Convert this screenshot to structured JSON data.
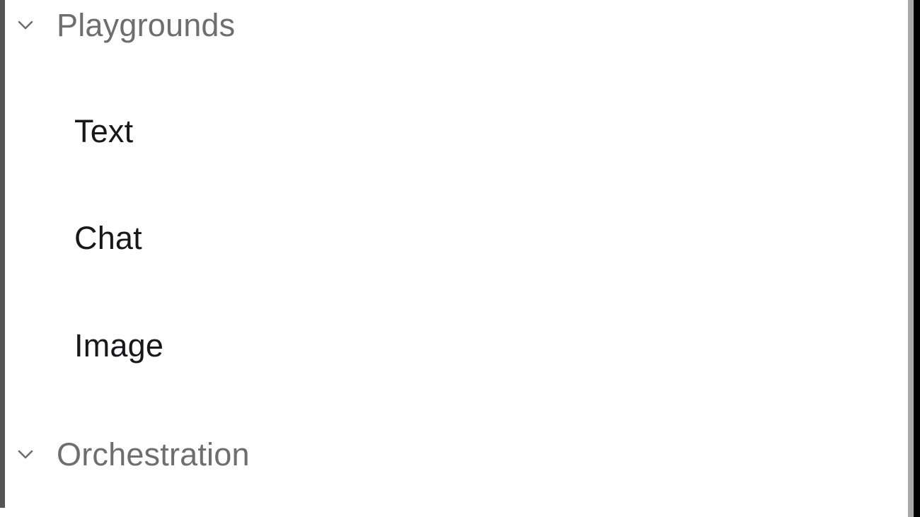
{
  "sidebar": {
    "groups": [
      {
        "id": "playgrounds",
        "label": "Playgrounds",
        "icon": "chevron-down-icon",
        "expanded": true,
        "items": [
          {
            "id": "text",
            "label": "Text"
          },
          {
            "id": "chat",
            "label": "Chat"
          },
          {
            "id": "image",
            "label": "Image"
          }
        ]
      },
      {
        "id": "orchestration",
        "label": "Orchestration",
        "icon": "chevron-down-icon",
        "expanded": true,
        "items": []
      }
    ]
  },
  "colors": {
    "group_label": "#6e6e6e",
    "item_label": "#18181b",
    "chevron": "#6e6e6e",
    "background": "#ffffff",
    "left_edge": "#555555",
    "scrollbar_track": "#a8a8a8",
    "right_edge": "#000000"
  }
}
